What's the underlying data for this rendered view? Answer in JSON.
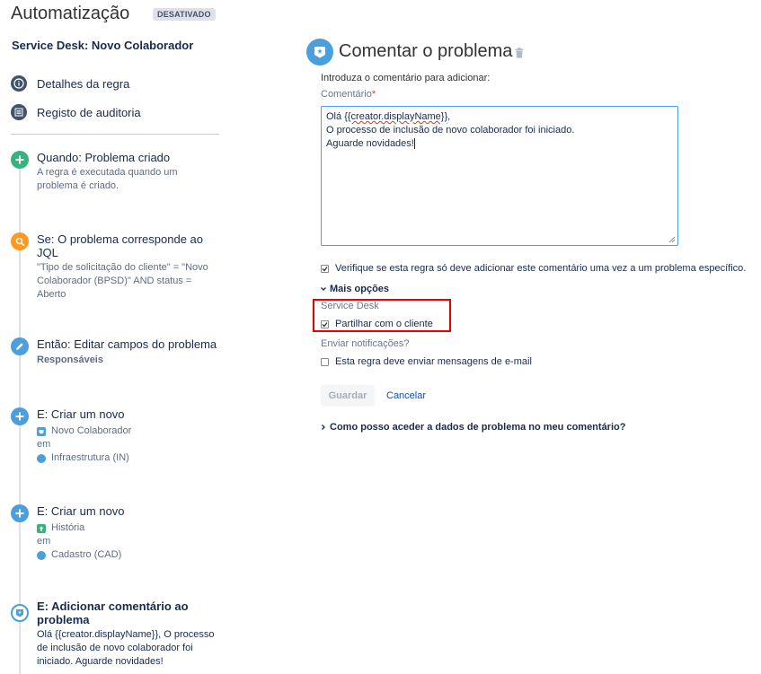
{
  "header": {
    "title": "Automatização",
    "status_badge": "DESATIVADO",
    "rule_name": "Service Desk: Novo Colaborador"
  },
  "nav": {
    "rule_details": "Detalhes da regra",
    "audit_log": "Registo de auditoria"
  },
  "steps": [
    {
      "title": "Quando: Problema criado",
      "desc": "A regra é executada quando um problema é criado.",
      "icon": "plus-icon",
      "color": "#36b37e"
    },
    {
      "title": "Se: O problema corresponde ao JQL",
      "desc": "\"Tipo de solicitação do cliente\" = \"Novo Colaborador (BPSD)\" AND status = Aberto",
      "icon": "search-icon",
      "color": "#ff991f"
    },
    {
      "title": "Então: Editar campos do problema",
      "sub": "Responsáveis",
      "icon": "pencil-icon",
      "color": "#4a9fdc"
    },
    {
      "title": "E: Criar um novo",
      "type": "Novo Colaborador",
      "in_label": "em",
      "project": "Infraestrutura (IN)",
      "icon": "plus-icon",
      "color": "#4a9fdc"
    },
    {
      "title": "E: Criar um novo",
      "type": "História",
      "in_label": "em",
      "project": "Cadastro (CAD)",
      "icon": "plus-icon",
      "color": "#4a9fdc"
    },
    {
      "title": "E: Adicionar comentário ao problema",
      "desc": "Olá {{creator.displayName}}, O processo de inclusão de novo colaborador foi iniciado. Aguarde novidades!",
      "icon": "comment-icon",
      "color": "#4a9fdc"
    }
  ],
  "panel": {
    "title": "Comentar o problema",
    "intro": "Introduza o comentário para adicionar:",
    "comment_label": "Comentário",
    "required_mark": "*",
    "comment_line1_prefix": "Olá ",
    "comment_line1_token": "{{creator.displayName}}",
    "comment_line1_suffix": ",",
    "comment_line2": "O processo de inclusão de novo colaborador foi iniciado.",
    "comment_line3": "Aguarde novidades!",
    "verify_checkbox": "Verifique se esta regra só deve adicionar este comentário uma vez a um problema específico.",
    "more_options": "Mais opções",
    "service_desk_label": "Service Desk",
    "share_checkbox": "Partilhar com o cliente",
    "notifications_label": "Enviar notificações?",
    "email_checkbox": "Esta regra deve enviar mensagens de e-mail",
    "save_button": "Guardar",
    "cancel_button": "Cancelar",
    "help_link": "Como posso aceder a dados de problema no meu comentário?"
  }
}
